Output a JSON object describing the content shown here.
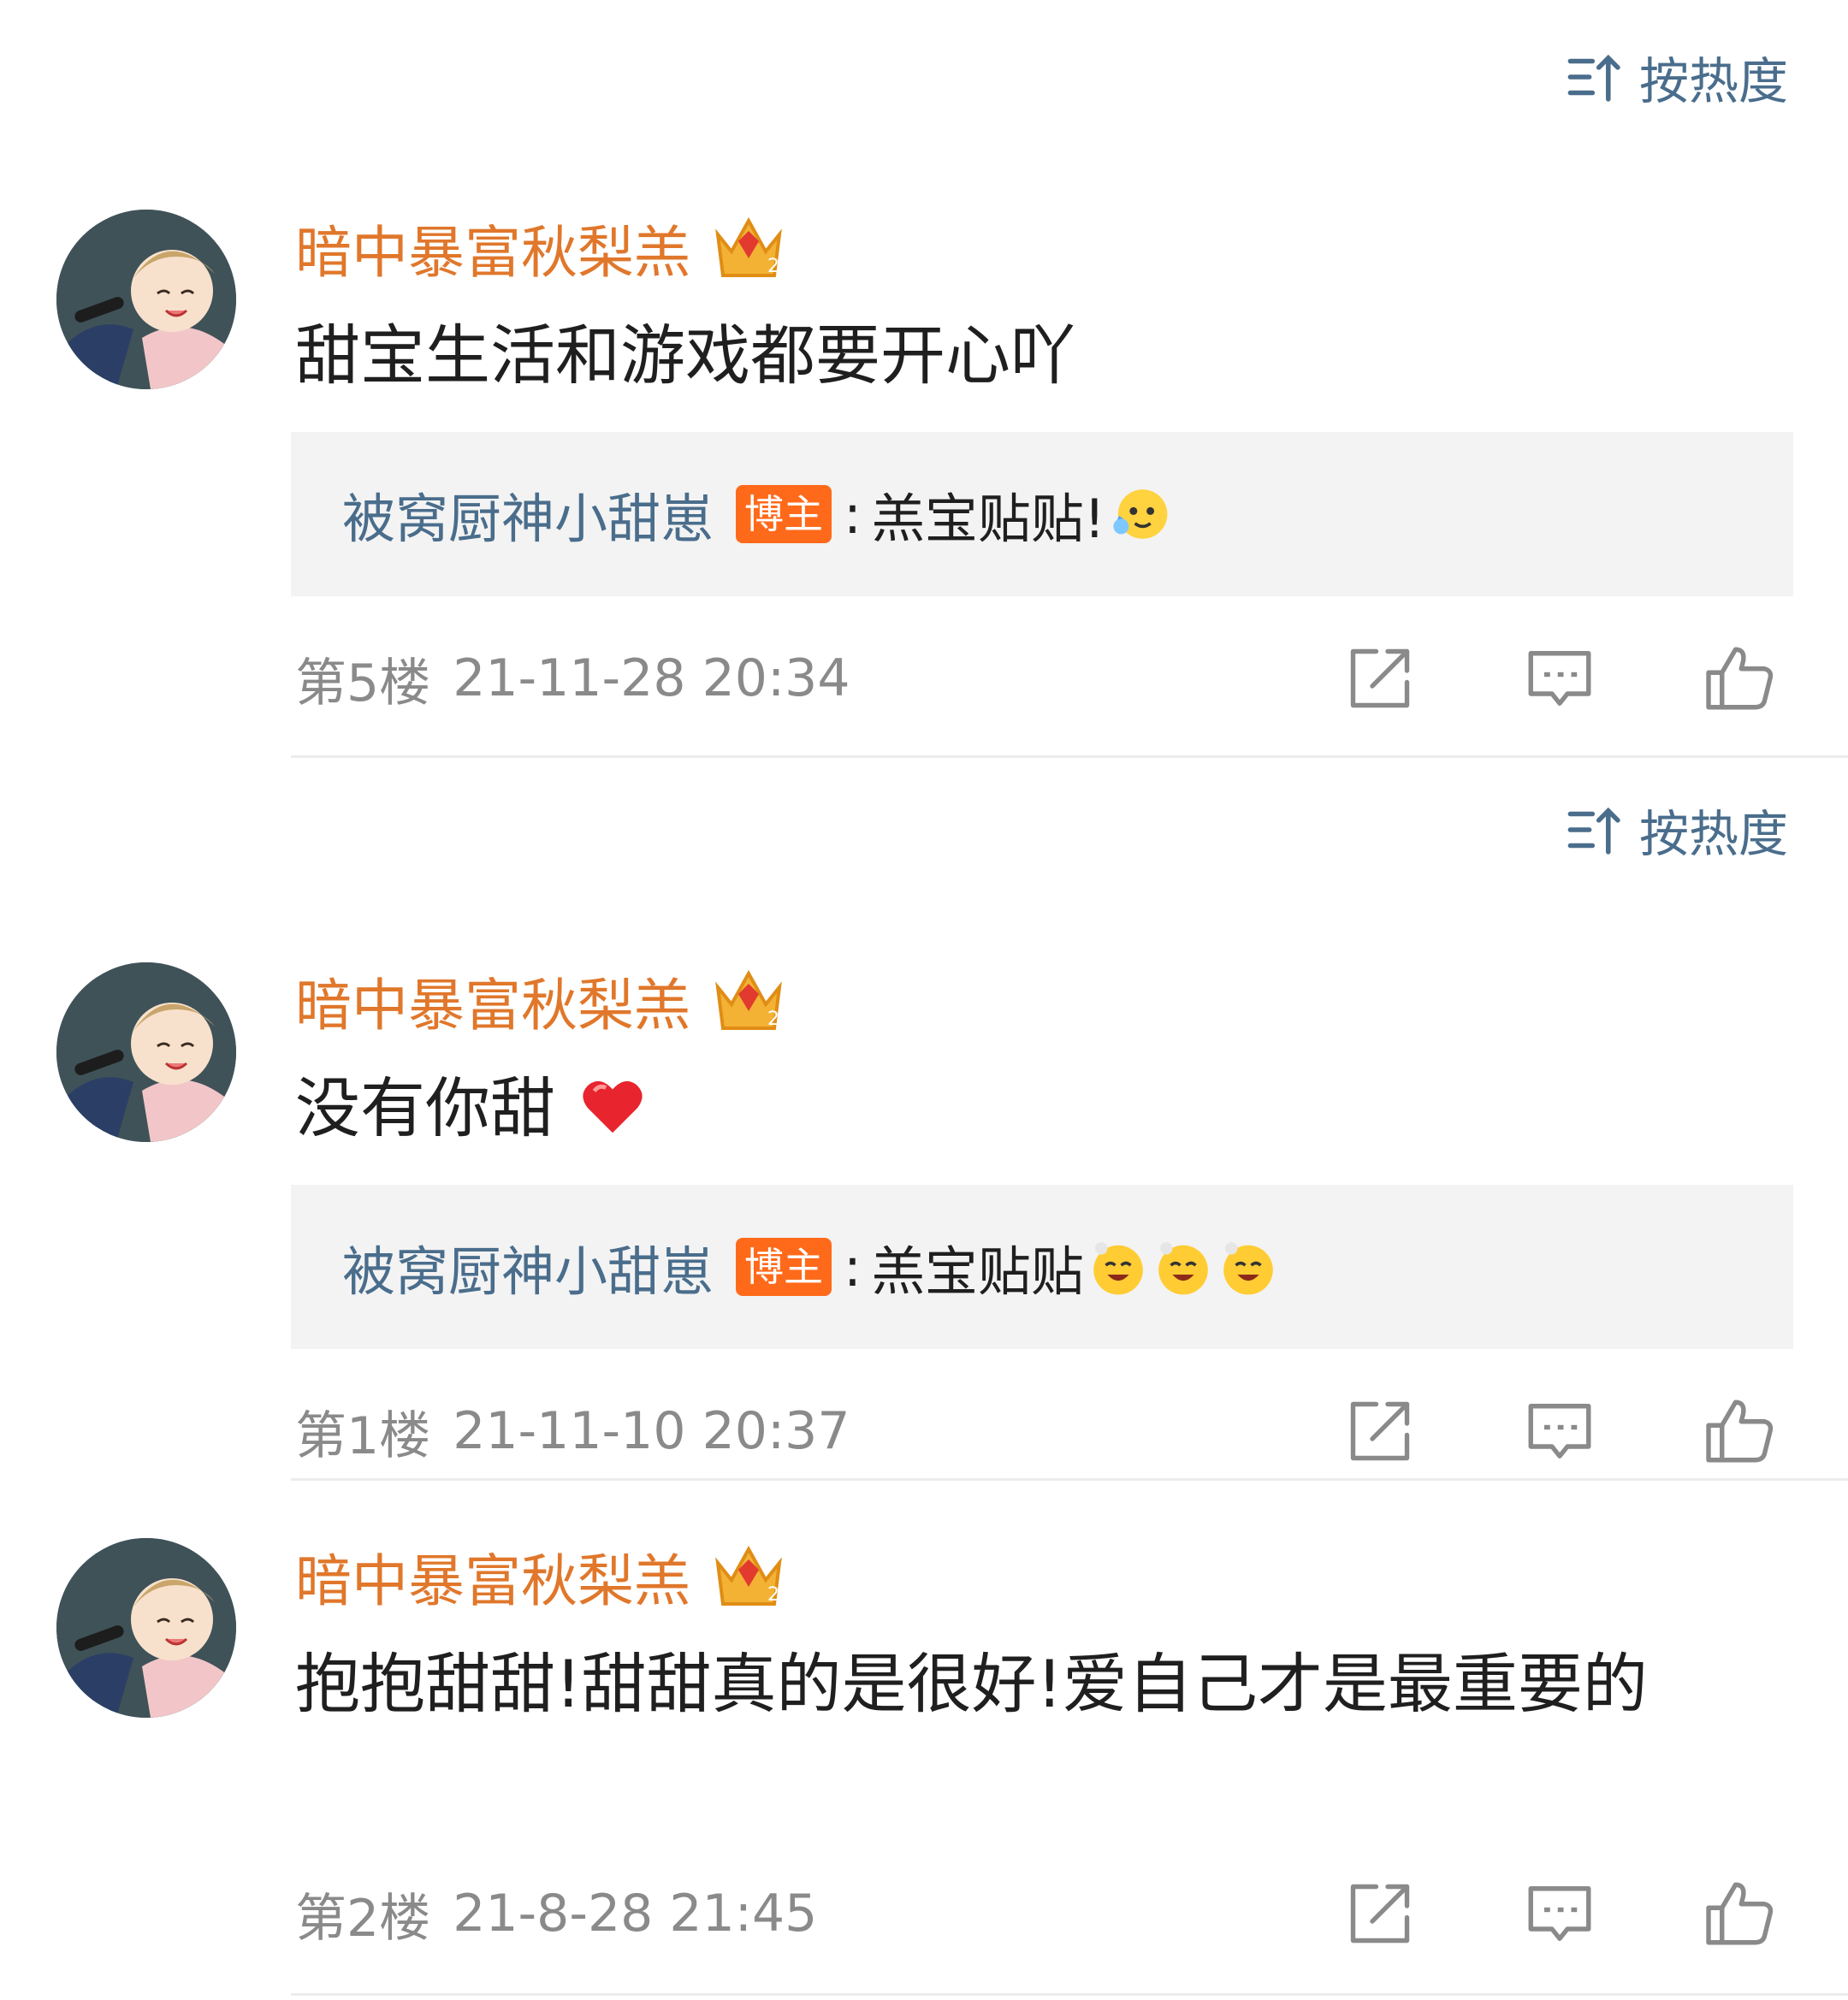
{
  "sort_label": "按热度",
  "comments": [
    {
      "user": "暗中暴富秋梨羔",
      "text": "甜宝生活和游戏都要开心吖",
      "reply": {
        "name": "被窝厨神小甜崽",
        "badge": "博主",
        "sep": ":",
        "text": "羔宝贴贴!"
      },
      "floor": "第5楼",
      "time": "21-11-28 20:34"
    },
    {
      "user": "暗中暴富秋梨羔",
      "text": "没有你甜",
      "reply": {
        "name": "被窝厨神小甜崽",
        "badge": "博主",
        "sep": ":",
        "text": "羔宝贴贴"
      },
      "floor": "第1楼",
      "time": "21-11-10 20:37"
    },
    {
      "user": "暗中暴富秋梨羔",
      "text": "抱抱甜甜!甜甜真的是很好!爱自己才是最重要的",
      "floor": "第2楼",
      "time": "21-8-28 21:45"
    }
  ],
  "icons": {
    "sort": "sort-hot-icon",
    "crown": "crown-vip-icon",
    "share": "share-icon",
    "reply": "comment-icon",
    "like": "thumbs-up-icon",
    "heart": "heart-emoji",
    "emoji_cry": "hug-cry-emoji",
    "emoji_smile": "smile-emoji"
  },
  "colors": {
    "username": "#e0772b",
    "link": "#4a6d8c",
    "badge": "#ff6a1a",
    "meta": "#8a8a8a",
    "reply_bg": "#f3f3f3"
  }
}
